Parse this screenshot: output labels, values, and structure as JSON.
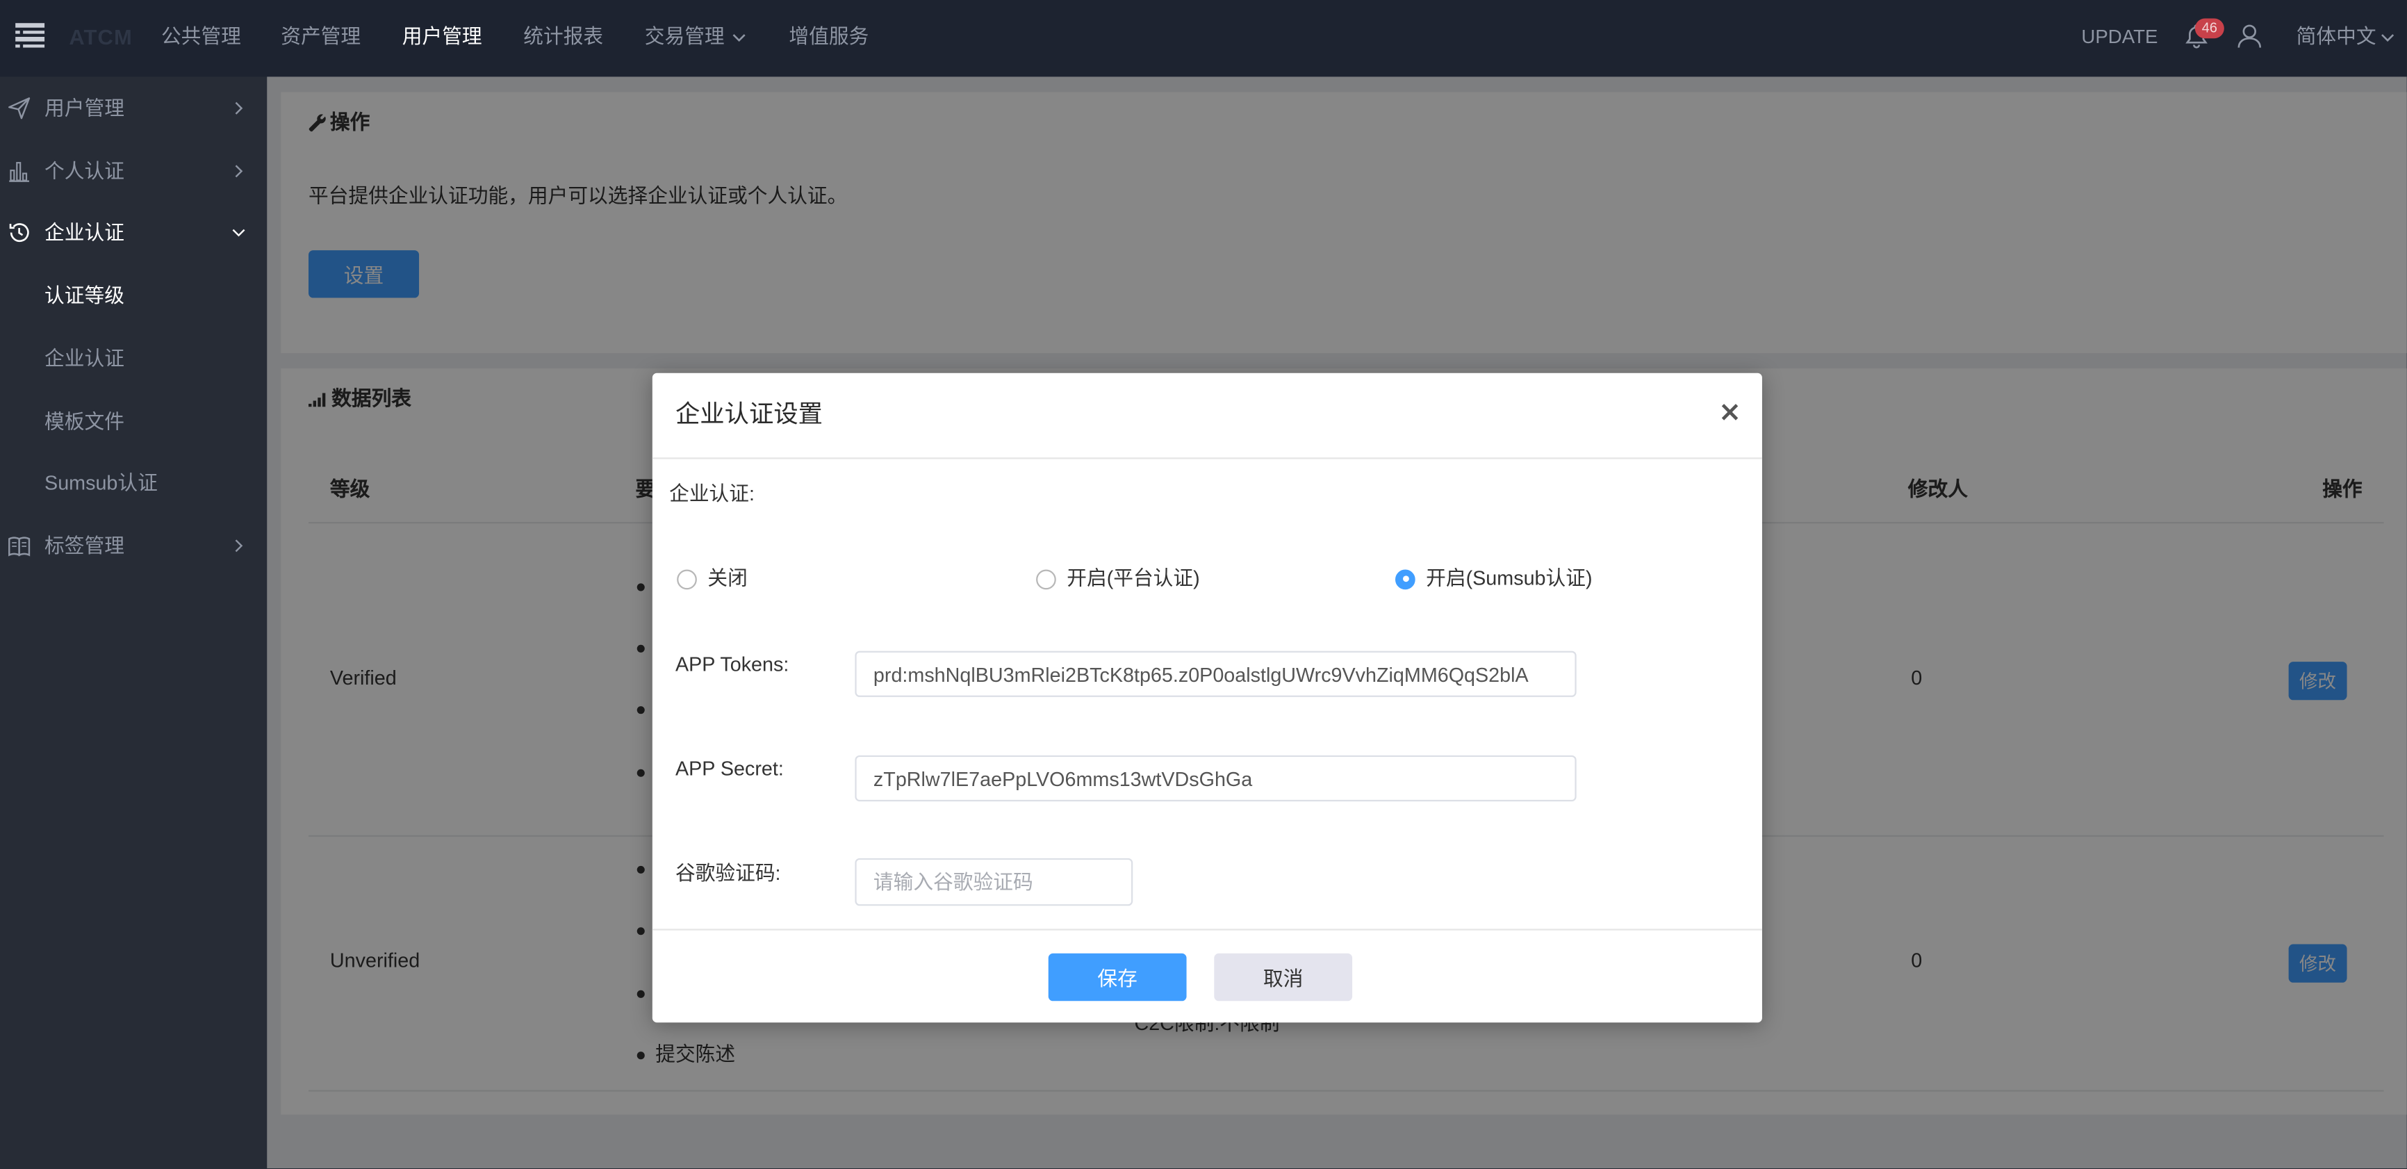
{
  "app": {
    "logo_text": "ATCM",
    "logo_icon": "menu-stack-icon"
  },
  "colors": {
    "primary": "#409eff",
    "topbar_bg": "#1d2330",
    "sidebar_bg": "#272c36",
    "badge": "#c8414a"
  },
  "topnav": {
    "items": [
      {
        "label": "公共管理",
        "active": false
      },
      {
        "label": "资产管理",
        "active": false
      },
      {
        "label": "用户管理",
        "active": true
      },
      {
        "label": "统计报表",
        "active": false
      },
      {
        "label": "交易管理",
        "active": false,
        "icon": "chevron-down-icon"
      },
      {
        "label": "增值服务",
        "active": false
      }
    ],
    "update_label": "UPDATE",
    "notification_icon": "bell-icon",
    "notification_count": "46",
    "user_icon": "user-icon",
    "language": "简体中文",
    "language_icon": "chevron-down-icon"
  },
  "sidebar": {
    "items": [
      {
        "label": "用户管理",
        "icon": "send-icon",
        "expanded": false,
        "active": false
      },
      {
        "label": "个人认证",
        "icon": "bar-chart-icon",
        "expanded": false,
        "active": false
      },
      {
        "label": "企业认证",
        "icon": "history-icon",
        "expanded": true,
        "active": true,
        "children": [
          {
            "label": "认证等级",
            "active": true
          },
          {
            "label": "企业认证",
            "active": false
          },
          {
            "label": "模板文件",
            "active": false
          },
          {
            "label": "Sumsub认证",
            "active": false
          }
        ]
      },
      {
        "label": "标签管理",
        "icon": "book-icon",
        "expanded": false,
        "active": false
      }
    ]
  },
  "operation_panel": {
    "icon": "wrench-icon",
    "title": "操作",
    "description": "平台提供企业认证功能，用户可以选择企业认证或个人认证。",
    "settings_button": "设置"
  },
  "data_list": {
    "icon": "signal-icon",
    "title": "数据列表",
    "columns": [
      "等级",
      "要",
      "修改人",
      "操作"
    ],
    "rows": [
      {
        "level": "Verified",
        "requirements": [
          "",
          "",
          "",
          ""
        ],
        "limit_text": "",
        "modifier": "0",
        "action": "修改"
      },
      {
        "level": "Unverified",
        "requirements": [
          "",
          "",
          "",
          "提交陈述"
        ],
        "limit_text": "C2C限制:不限制",
        "modifier": "0",
        "action": "修改"
      }
    ]
  },
  "modal": {
    "title": "企业认证设置",
    "close_symbol": "×",
    "field_label": "企业认证:",
    "options": [
      {
        "label": "关闭",
        "checked": false
      },
      {
        "label": "开启(平台认证)",
        "checked": false
      },
      {
        "label": "开启(Sumsub认证)",
        "checked": true
      }
    ],
    "app_tokens": {
      "label": "APP Tokens:",
      "value": "prd:mshNqlBU3mRlei2BTcK8tp65.z0P0oalstlgUWrc9VvhZiqMM6QqS2blA"
    },
    "app_secret": {
      "label": "APP Secret:",
      "value": "zTpRlw7lE7aePpLVO6mms13wtVDsGhGa"
    },
    "google_code": {
      "label": "谷歌验证码:",
      "placeholder": "请输入谷歌验证码"
    },
    "save_button": "保存",
    "cancel_button": "取消"
  }
}
